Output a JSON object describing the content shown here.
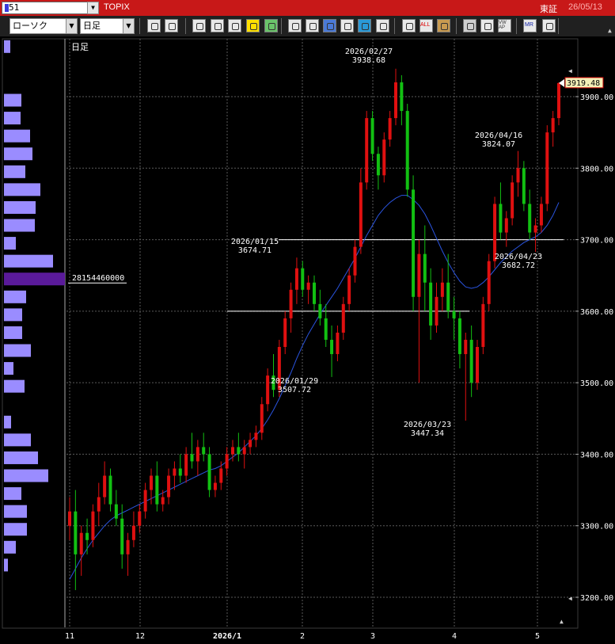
{
  "header": {
    "code_value": "51",
    "index_name": "TOPIX",
    "market": "東証",
    "date": "26/05/13"
  },
  "toolbar": {
    "chart_type_value": "ローソク",
    "period_value": "日足",
    "buttons": [
      {
        "icon": "zoom-icon"
      },
      {
        "icon": "compare-icon"
      },
      {
        "icon": "marker-icon"
      },
      {
        "icon": "grid-icon"
      },
      {
        "icon": "arrows-icon"
      },
      {
        "icon": "warning-icon"
      },
      {
        "icon": "pen-icon"
      },
      {
        "icon": "fill-icon"
      },
      {
        "icon": "cursor-icon"
      },
      {
        "icon": "erase-icon"
      },
      {
        "icon": "note-icon"
      },
      {
        "icon": "trash-icon"
      },
      {
        "icon": "candle-icon"
      },
      {
        "icon": "candle-range-icon"
      },
      {
        "icon": "all-icon"
      },
      {
        "icon": "settings-icon"
      },
      {
        "icon": "color-icon"
      },
      {
        "icon": "palette-icon"
      },
      {
        "icon": "vwap-icon"
      },
      {
        "icon": "mr-icon"
      },
      {
        "icon": "menu-icon"
      }
    ],
    "all_label": "ALL",
    "vw_label": "VW AP",
    "mr_label": "MR"
  },
  "chart_data": {
    "type": "candlestick",
    "title": "日足",
    "ylim": [
      3185,
      3990
    ],
    "y_ticks": [
      3200,
      3300,
      3400,
      3500,
      3600,
      3700,
      3800,
      3900
    ],
    "y_tick_labels": [
      "3200.00",
      "3300.00",
      "3400.00",
      "3500.00",
      "3600.00",
      "3700.00",
      "3800.00",
      "3900.00"
    ],
    "x_tick_labels": [
      "11",
      "12",
      "2026/1",
      "2",
      "3",
      "4",
      "5"
    ],
    "last_price_label": "3919.48",
    "moving_average_color": "#2a54e0",
    "up_color": "#e01010",
    "down_color": "#12c012",
    "horizontal_lines": [
      3700,
      3600
    ],
    "annotations": [
      {
        "date": "2026/02/27",
        "value": "3938.68"
      },
      {
        "date": "2026/01/15",
        "value": "3674.71"
      },
      {
        "date": "2026/01/29",
        "value": "3507.72"
      },
      {
        "date": "2026/03/23",
        "value": "3447.34"
      },
      {
        "date": "2026/04/16",
        "value": "3824.07"
      },
      {
        "date": "2026/04/23",
        "value": "3682.72"
      }
    ],
    "volume_profile": {
      "highlight_label": "28154460000",
      "bar_color": "#9a8cff",
      "highlight_color": "#5a1a9a",
      "levels": [
        {
          "price": 3970,
          "volume": 8
        },
        {
          "price": 3920,
          "volume": 0
        },
        {
          "price": 3895,
          "volume": 22
        },
        {
          "price": 3870,
          "volume": 21
        },
        {
          "price": 3845,
          "volume": 33
        },
        {
          "price": 3820,
          "volume": 36
        },
        {
          "price": 3795,
          "volume": 27
        },
        {
          "price": 3770,
          "volume": 46
        },
        {
          "price": 3745,
          "volume": 40
        },
        {
          "price": 3720,
          "volume": 39
        },
        {
          "price": 3695,
          "volume": 15
        },
        {
          "price": 3670,
          "volume": 62
        },
        {
          "price": 3645,
          "volume": 77,
          "highlight": true
        },
        {
          "price": 3620,
          "volume": 28
        },
        {
          "price": 3595,
          "volume": 23
        },
        {
          "price": 3570,
          "volume": 23
        },
        {
          "price": 3545,
          "volume": 34
        },
        {
          "price": 3520,
          "volume": 12
        },
        {
          "price": 3495,
          "volume": 26
        },
        {
          "price": 3470,
          "volume": 0
        },
        {
          "price": 3445,
          "volume": 9
        },
        {
          "price": 3420,
          "volume": 34
        },
        {
          "price": 3395,
          "volume": 43
        },
        {
          "price": 3370,
          "volume": 56
        },
        {
          "price": 3345,
          "volume": 22
        },
        {
          "price": 3320,
          "volume": 29
        },
        {
          "price": 3295,
          "volume": 29
        },
        {
          "price": 3270,
          "volume": 15
        },
        {
          "price": 3245,
          "volume": 5
        }
      ]
    },
    "candles": [
      [
        3300,
        3340,
        3280,
        3320
      ],
      [
        3320,
        3350,
        3210,
        3260
      ],
      [
        3260,
        3300,
        3230,
        3290
      ],
      [
        3290,
        3310,
        3260,
        3280
      ],
      [
        3280,
        3330,
        3270,
        3320
      ],
      [
        3320,
        3360,
        3300,
        3340
      ],
      [
        3340,
        3390,
        3330,
        3370
      ],
      [
        3370,
        3380,
        3320,
        3330
      ],
      [
        3330,
        3350,
        3300,
        3310
      ],
      [
        3310,
        3330,
        3240,
        3260
      ],
      [
        3260,
        3290,
        3230,
        3280
      ],
      [
        3280,
        3320,
        3270,
        3300
      ],
      [
        3300,
        3330,
        3290,
        3320
      ],
      [
        3320,
        3360,
        3310,
        3350
      ],
      [
        3350,
        3380,
        3330,
        3370
      ],
      [
        3370,
        3390,
        3320,
        3330
      ],
      [
        3330,
        3350,
        3320,
        3340
      ],
      [
        3340,
        3380,
        3330,
        3370
      ],
      [
        3370,
        3390,
        3350,
        3380
      ],
      [
        3380,
        3400,
        3360,
        3370
      ],
      [
        3370,
        3410,
        3360,
        3400
      ],
      [
        3400,
        3430,
        3380,
        3390
      ],
      [
        3390,
        3420,
        3370,
        3410
      ],
      [
        3410,
        3430,
        3390,
        3400
      ],
      [
        3400,
        3410,
        3340,
        3350
      ],
      [
        3350,
        3370,
        3340,
        3360
      ],
      [
        3360,
        3390,
        3350,
        3380
      ],
      [
        3380,
        3410,
        3370,
        3400
      ],
      [
        3400,
        3420,
        3390,
        3410
      ],
      [
        3410,
        3430,
        3390,
        3400
      ],
      [
        3400,
        3420,
        3380,
        3410
      ],
      [
        3410,
        3430,
        3400,
        3420
      ],
      [
        3420,
        3440,
        3410,
        3430
      ],
      [
        3430,
        3480,
        3420,
        3470
      ],
      [
        3470,
        3520,
        3460,
        3510
      ],
      [
        3510,
        3540,
        3480,
        3490
      ],
      [
        3490,
        3560,
        3480,
        3550
      ],
      [
        3550,
        3600,
        3540,
        3590
      ],
      [
        3590,
        3640,
        3570,
        3630
      ],
      [
        3630,
        3675,
        3610,
        3660
      ],
      [
        3660,
        3670,
        3620,
        3630
      ],
      [
        3630,
        3650,
        3610,
        3640
      ],
      [
        3640,
        3650,
        3600,
        3610
      ],
      [
        3610,
        3630,
        3580,
        3590
      ],
      [
        3590,
        3610,
        3550,
        3560
      ],
      [
        3560,
        3580,
        3508,
        3540
      ],
      [
        3540,
        3580,
        3530,
        3570
      ],
      [
        3570,
        3620,
        3560,
        3610
      ],
      [
        3610,
        3660,
        3600,
        3650
      ],
      [
        3650,
        3700,
        3640,
        3690
      ],
      [
        3690,
        3800,
        3680,
        3780
      ],
      [
        3780,
        3880,
        3770,
        3870
      ],
      [
        3870,
        3880,
        3810,
        3820
      ],
      [
        3820,
        3830,
        3770,
        3790
      ],
      [
        3790,
        3850,
        3780,
        3840
      ],
      [
        3840,
        3880,
        3830,
        3870
      ],
      [
        3870,
        3939,
        3860,
        3920
      ],
      [
        3920,
        3930,
        3860,
        3880
      ],
      [
        3880,
        3890,
        3760,
        3770
      ],
      [
        3770,
        3790,
        3600,
        3620
      ],
      [
        3620,
        3700,
        3500,
        3680
      ],
      [
        3680,
        3720,
        3600,
        3640
      ],
      [
        3640,
        3660,
        3560,
        3580
      ],
      [
        3580,
        3640,
        3570,
        3620
      ],
      [
        3620,
        3660,
        3600,
        3640
      ],
      [
        3640,
        3680,
        3590,
        3600
      ],
      [
        3600,
        3620,
        3560,
        3590
      ],
      [
        3590,
        3600,
        3520,
        3540
      ],
      [
        3540,
        3570,
        3447,
        3560
      ],
      [
        3560,
        3580,
        3480,
        3500
      ],
      [
        3500,
        3560,
        3490,
        3550
      ],
      [
        3550,
        3620,
        3540,
        3610
      ],
      [
        3610,
        3680,
        3600,
        3670
      ],
      [
        3670,
        3760,
        3660,
        3750
      ],
      [
        3750,
        3780,
        3700,
        3710
      ],
      [
        3710,
        3740,
        3690,
        3730
      ],
      [
        3730,
        3790,
        3720,
        3780
      ],
      [
        3780,
        3824,
        3760,
        3800
      ],
      [
        3800,
        3810,
        3740,
        3750
      ],
      [
        3750,
        3770,
        3700,
        3710
      ],
      [
        3710,
        3730,
        3683,
        3720
      ],
      [
        3720,
        3760,
        3710,
        3750
      ],
      [
        3750,
        3860,
        3740,
        3850
      ],
      [
        3850,
        3880,
        3830,
        3870
      ],
      [
        3870,
        3920,
        3860,
        3919
      ]
    ],
    "moving_average": [
      3225,
      3240,
      3255,
      3268,
      3280,
      3290,
      3300,
      3308,
      3314,
      3318,
      3322,
      3326,
      3330,
      3334,
      3338,
      3342,
      3346,
      3350,
      3354,
      3358,
      3362,
      3366,
      3370,
      3374,
      3378,
      3380,
      3384,
      3390,
      3396,
      3402,
      3410,
      3418,
      3426,
      3436,
      3448,
      3462,
      3478,
      3496,
      3514,
      3534,
      3552,
      3568,
      3582,
      3596,
      3608,
      3620,
      3632,
      3646,
      3660,
      3674,
      3690,
      3706,
      3720,
      3734,
      3744,
      3752,
      3758,
      3762,
      3762,
      3756,
      3748,
      3736,
      3720,
      3702,
      3684,
      3668,
      3654,
      3642,
      3634,
      3632,
      3634,
      3640,
      3648,
      3658,
      3668,
      3676,
      3684,
      3690,
      3696,
      3700,
      3704,
      3710,
      3720,
      3734,
      3752
    ]
  }
}
